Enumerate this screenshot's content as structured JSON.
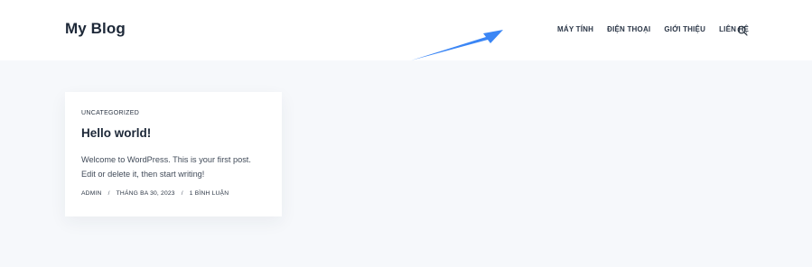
{
  "header": {
    "site_title": "My Blog",
    "nav": [
      {
        "label": "MÁY TÍNH"
      },
      {
        "label": "ĐIỆN THOẠI"
      },
      {
        "label": "GIỚI THIỆU"
      },
      {
        "label": "LIÊN HỆ"
      }
    ],
    "search_icon": "search-icon"
  },
  "annotation": {
    "arrow_color": "#3b86f5"
  },
  "post": {
    "category": "UNCATEGORIZED",
    "title": "Hello world!",
    "excerpt_line1": "Welcome to WordPress. This is your first post.",
    "excerpt_line2": "Edit or delete it, then start writing!",
    "meta": {
      "author": "ADMIN",
      "separator": "/",
      "date": "THÁNG BA 30, 2023",
      "comments": "1 BÌNH LUẬN"
    }
  },
  "colors": {
    "page_bg": "#f6f8fb",
    "header_bg": "#ffffff",
    "text_dark": "#1d2838",
    "accent_arrow": "#3b86f5"
  }
}
